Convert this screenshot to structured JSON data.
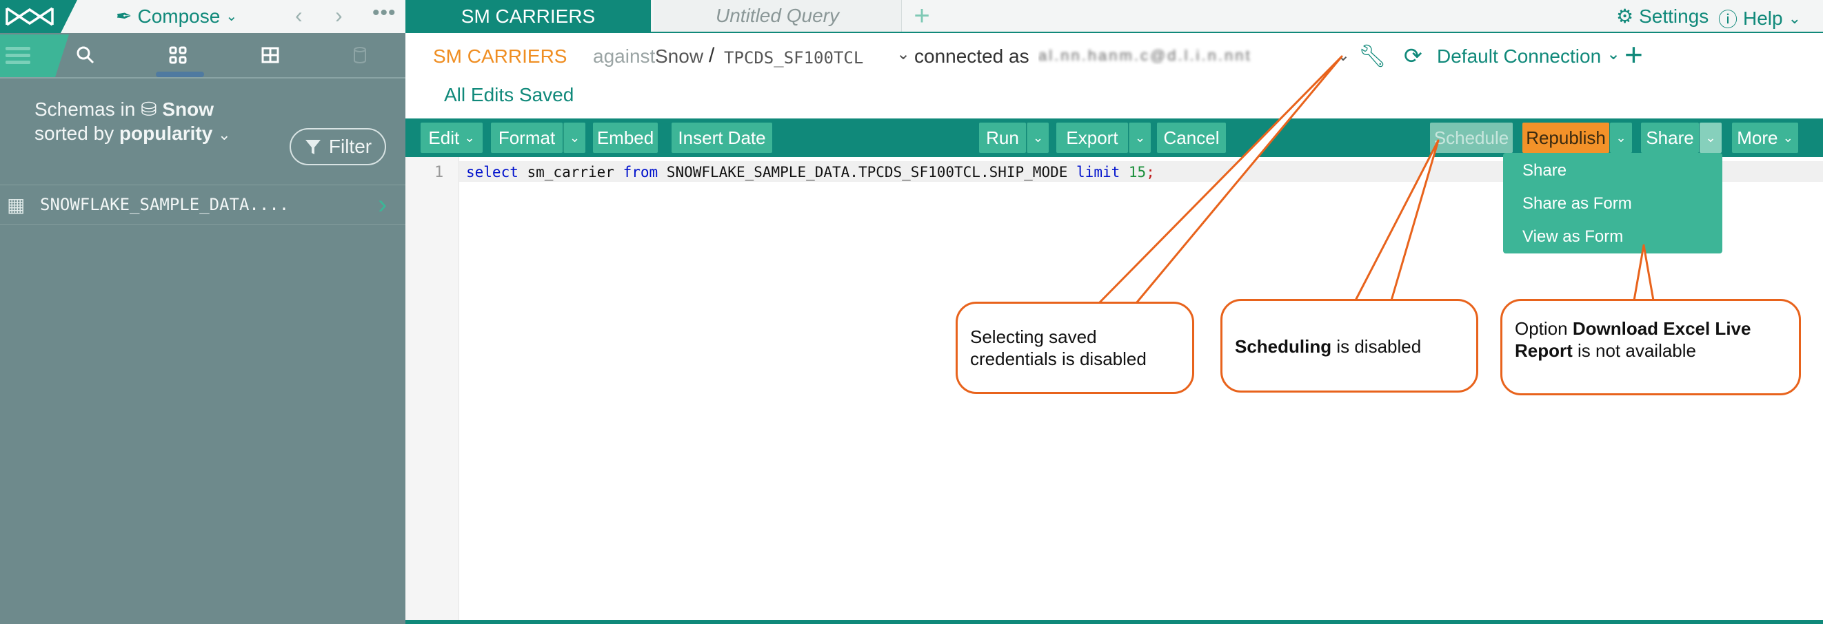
{
  "sidebar": {
    "compose_label": "Compose",
    "schemas_in_prefix": "Schemas in",
    "database_name": "Snow",
    "sorted_by_prefix": "sorted by",
    "sort_value": "popularity",
    "filter_label": "Filter",
    "schema_item": "SNOWFLAKE_SAMPLE_DATA...."
  },
  "tabs": {
    "active": "SM CARRIERS",
    "untitled": "Untitled Query",
    "add": "+"
  },
  "header": {
    "settings_label": "Settings",
    "help_label": "Help"
  },
  "query": {
    "title": "SM CARRIERS",
    "against_label": "against",
    "database": "Snow",
    "separator": "/",
    "schema": "TPCDS_SF100TCL",
    "connected_label": "connected as",
    "user_masked": "al.nn.hanm.c@d.l.i.n.nnt",
    "connection": "Default Connection",
    "save_status": "All Edits Saved"
  },
  "toolbar": {
    "edit": "Edit",
    "format": "Format",
    "embed": "Embed",
    "insert_date": "Insert Date",
    "run": "Run",
    "export": "Export",
    "cancel": "Cancel",
    "schedule": "Schedule",
    "republish": "Republish",
    "share": "Share",
    "more": "More"
  },
  "editor": {
    "line_number": "1",
    "sql": {
      "kw1": "select",
      "t1": " sm_carrier ",
      "kw2": "from",
      "t2": " SNOWFLAKE_SAMPLE_DATA.TPCDS_SF100TCL.SHIP_MODE ",
      "kw3": "limit",
      "t3": " ",
      "num": "15",
      "end": ";"
    }
  },
  "share_menu": {
    "items": [
      "Share",
      "Share as Form",
      "View as Form"
    ]
  },
  "callouts": {
    "credentials": "Selecting saved credentials is disabled",
    "scheduling_bold": "Scheduling",
    "scheduling_rest": " is disabled",
    "excel_prefix": "Option ",
    "excel_bold": "Download Excel Live Report",
    "excel_rest": " is not available"
  },
  "colors": {
    "brand_green": "#10897a",
    "button_green": "#3db597",
    "accent_orange": "#ef8e22",
    "callout_border": "#e8631c",
    "sidebar_bg": "#6e8a8c"
  }
}
